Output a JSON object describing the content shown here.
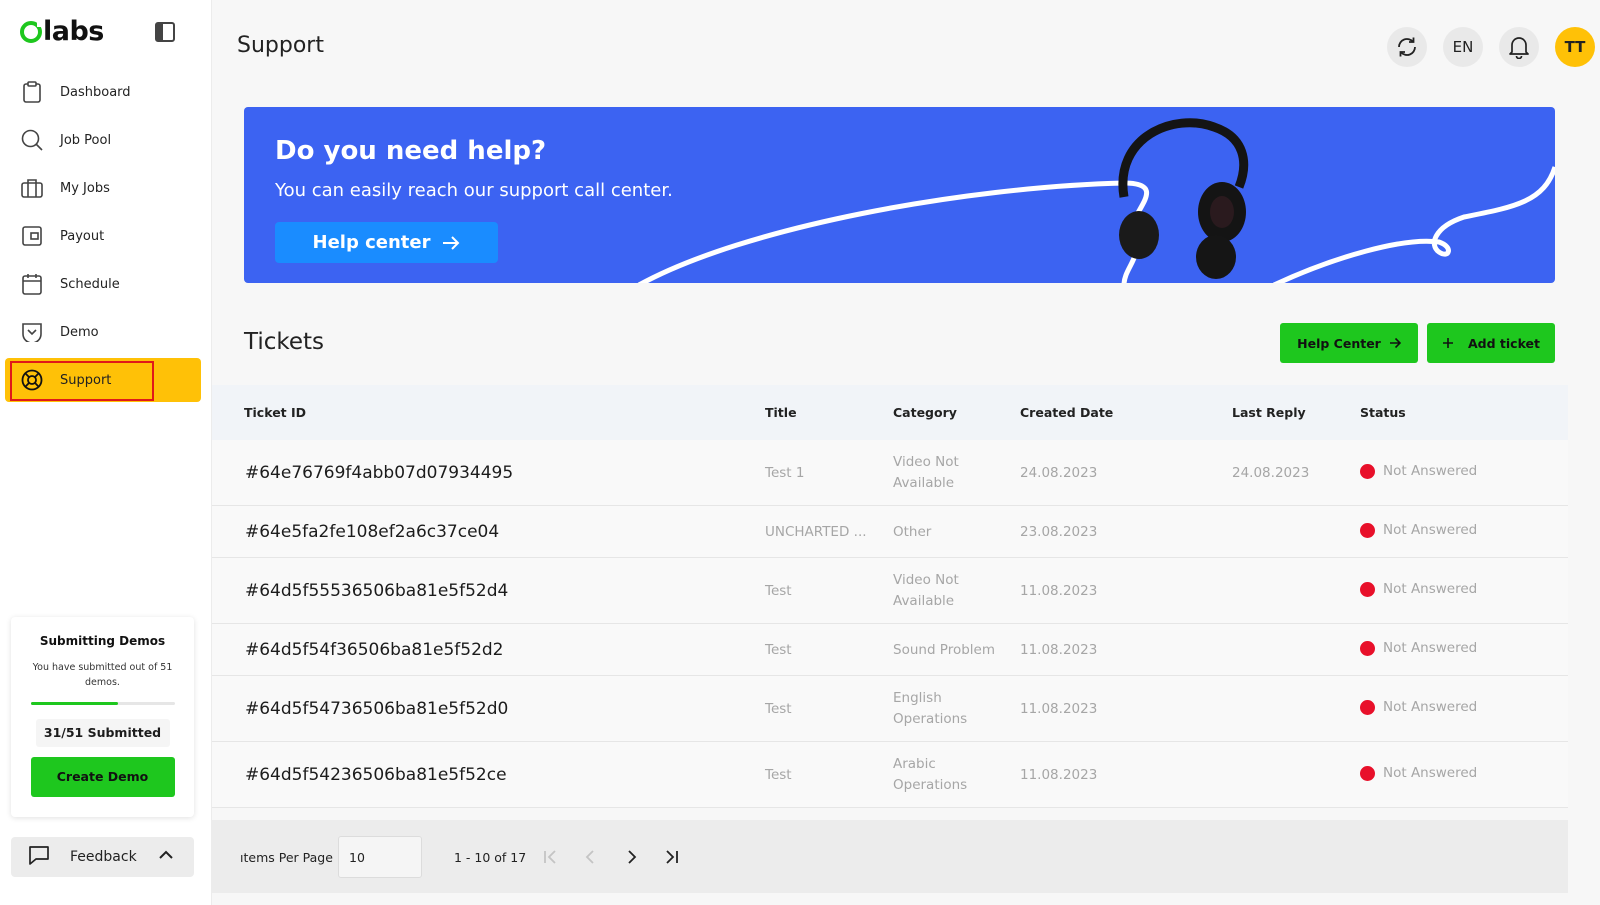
{
  "brand": {
    "name": "labs"
  },
  "sidebar": {
    "items": [
      {
        "label": "Dashboard",
        "icon": "clipboard-icon"
      },
      {
        "label": "Job Pool",
        "icon": "search-icon"
      },
      {
        "label": "My Jobs",
        "icon": "briefcase-icon"
      },
      {
        "label": "Payout",
        "icon": "wallet-icon"
      },
      {
        "label": "Schedule",
        "icon": "calendar-icon"
      },
      {
        "label": "Demo",
        "icon": "inbox-icon"
      },
      {
        "label": "Support",
        "icon": "lifebuoy-icon",
        "active": true
      }
    ],
    "demo_card": {
      "title": "Submitting Demos",
      "description": "You have submitted out of 51 demos.",
      "progress": 0.608,
      "submitted_label": "31/51 Submitted",
      "create_button": "Create Demo"
    },
    "feedback_label": "Feedback"
  },
  "header": {
    "title": "Support",
    "language": "EN",
    "avatar_initials": "TT"
  },
  "banner": {
    "heading": "Do you need help?",
    "text": "You can easily reach our support call center.",
    "button": "Help center"
  },
  "tickets": {
    "title": "Tickets",
    "help_center_button": "Help Center",
    "add_ticket_button": "Add ticket",
    "columns": [
      "Ticket ID",
      "Title",
      "Category",
      "Created Date",
      "Last Reply",
      "Status"
    ],
    "rows": [
      {
        "id": "#64e76769f4abb07d07934495",
        "title": "Test 1",
        "category": [
          "Video Not",
          "Available"
        ],
        "created": "24.08.2023",
        "last_reply": "24.08.2023",
        "status": "Not Answered"
      },
      {
        "id": "#64e5fa2fe108ef2a6c37ce04",
        "title": "UNCHARTED ...",
        "category": [
          "Other"
        ],
        "created": "23.08.2023",
        "last_reply": "",
        "status": "Not Answered"
      },
      {
        "id": "#64d5f55536506ba81e5f52d4",
        "title": "Test",
        "category": [
          "Video Not",
          "Available"
        ],
        "created": "11.08.2023",
        "last_reply": "",
        "status": "Not Answered"
      },
      {
        "id": "#64d5f54f36506ba81e5f52d2",
        "title": "Test",
        "category": [
          "Sound Problem"
        ],
        "created": "11.08.2023",
        "last_reply": "",
        "status": "Not Answered"
      },
      {
        "id": "#64d5f54736506ba81e5f52d0",
        "title": "Test",
        "category": [
          "English",
          "Operations"
        ],
        "created": "11.08.2023",
        "last_reply": "",
        "status": "Not Answered"
      },
      {
        "id": "#64d5f54236506ba81e5f52ce",
        "title": "Test",
        "category": [
          "Arabic",
          "Operations"
        ],
        "created": "11.08.2023",
        "last_reply": "",
        "status": "Not Answered"
      }
    ]
  },
  "pagination": {
    "items_per_page_label": "ıtems Per Page",
    "items_per_page": "10",
    "range": "1 - 10 of 17"
  },
  "colors": {
    "accent_green": "#1ec71e",
    "accent_yellow": "#ffc107",
    "banner_blue": "#3c63f2",
    "status_red": "#e8102a"
  }
}
